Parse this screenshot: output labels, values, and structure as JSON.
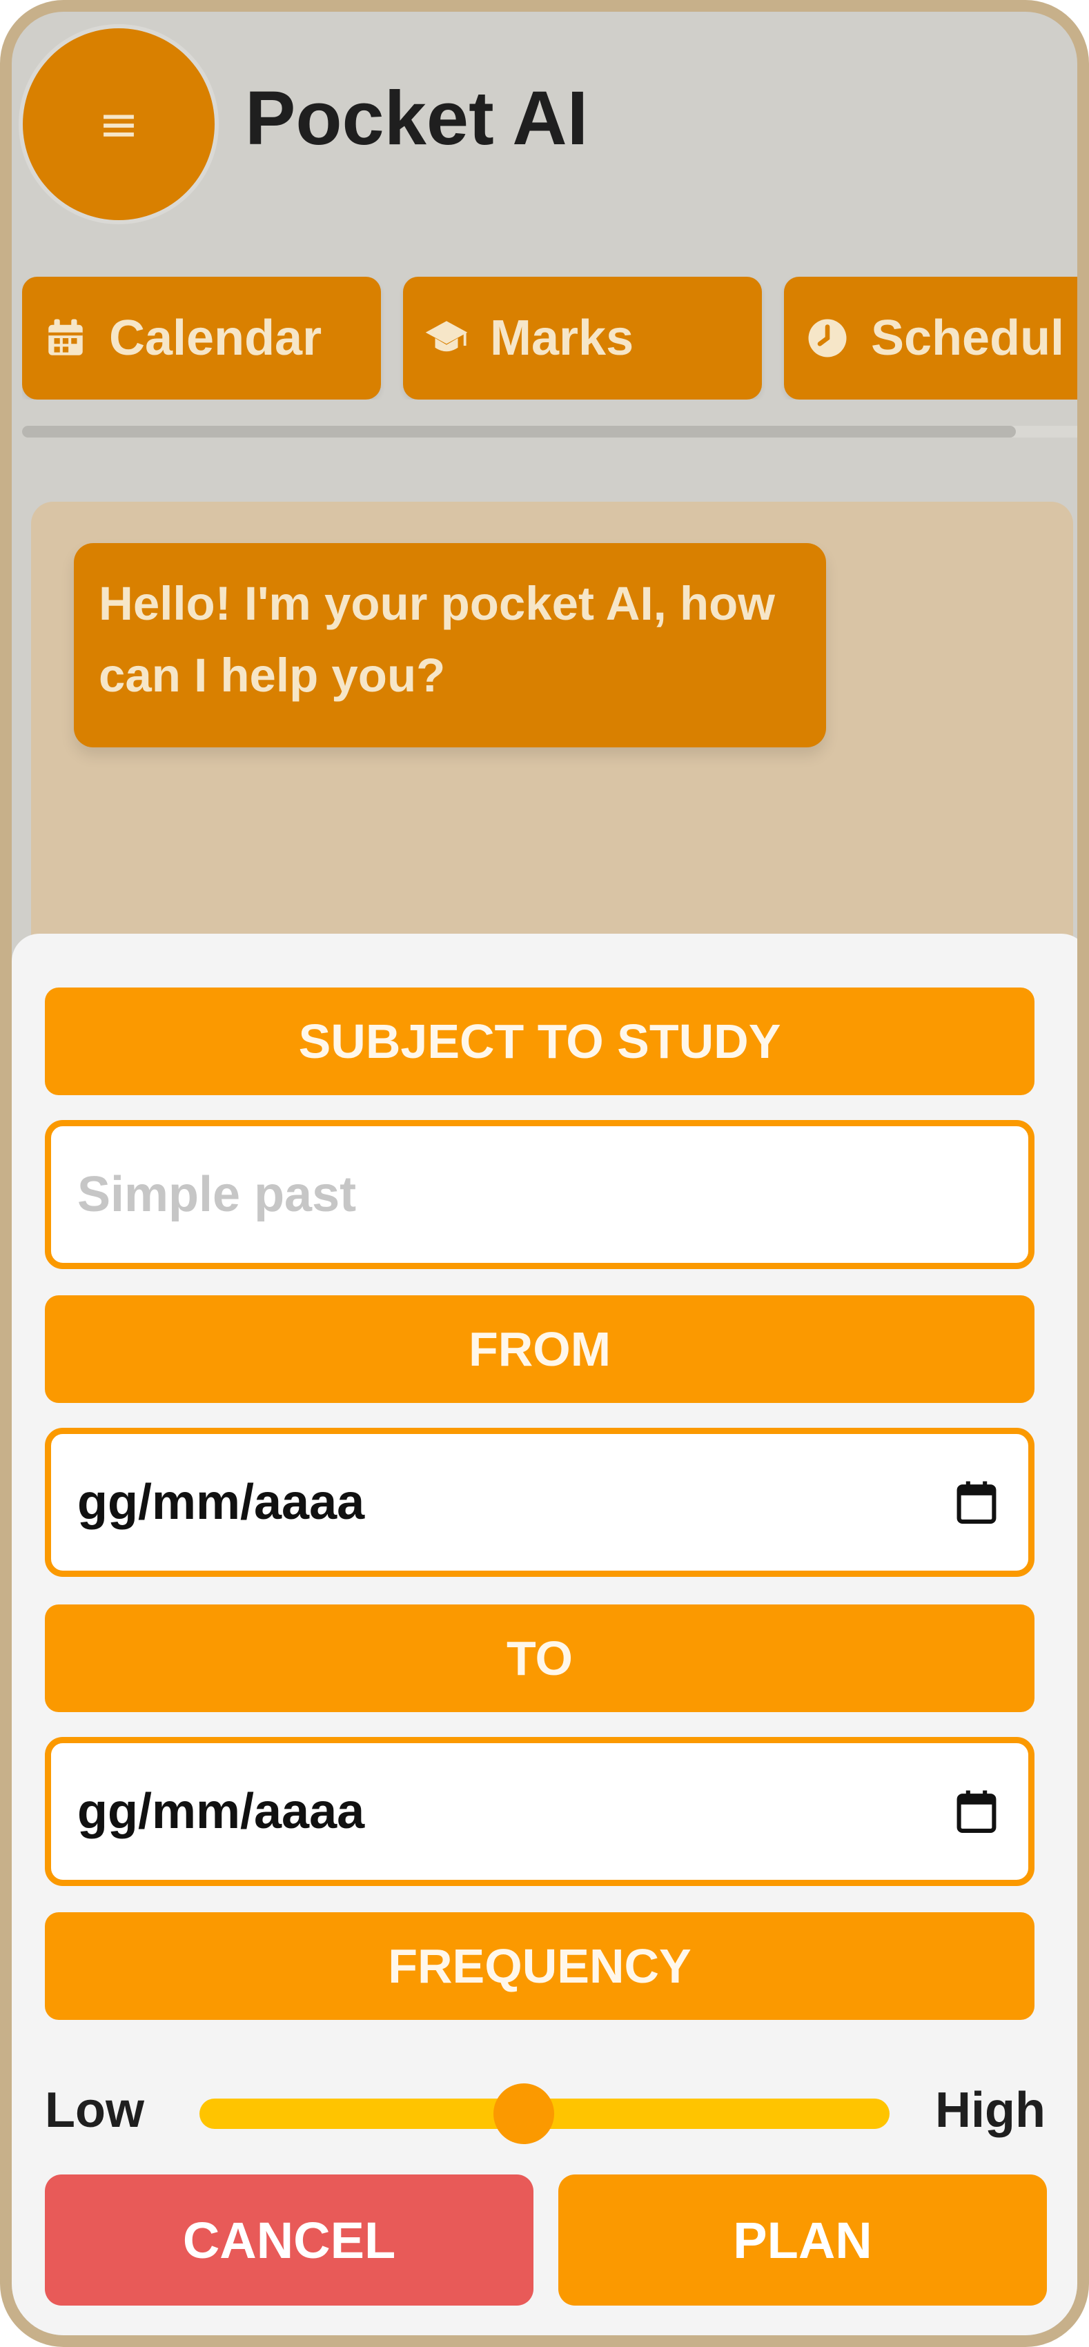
{
  "header": {
    "menu_icon": "≡",
    "title": "Pocket AI"
  },
  "tabs": [
    {
      "label": "Calendar",
      "icon": "calendar-icon"
    },
    {
      "label": "Marks",
      "icon": "graduation-cap-icon"
    },
    {
      "label": "Schedul",
      "icon": "clock-icon"
    }
  ],
  "chat": {
    "bot_message": "Hello! I'm your pocket AI, how can I help you?"
  },
  "form": {
    "subject_label": "SUBJECT TO STUDY",
    "subject_placeholder": "Simple past",
    "from_label": "FROM",
    "from_value": "gg/mm/aaaa",
    "to_label": "TO",
    "to_value": "gg/mm/aaaa",
    "frequency_label": "FREQUENCY",
    "frequency_low": "Low",
    "frequency_high": "High",
    "frequency_level": 0.47,
    "cancel_label": "CANCEL",
    "plan_label": "PLAN"
  },
  "colors": {
    "accent_dark": "#d98000",
    "accent": "#fb9900",
    "slider_track": "#ffc400",
    "cancel": "#e85a58",
    "frame": "#c7b08a"
  }
}
